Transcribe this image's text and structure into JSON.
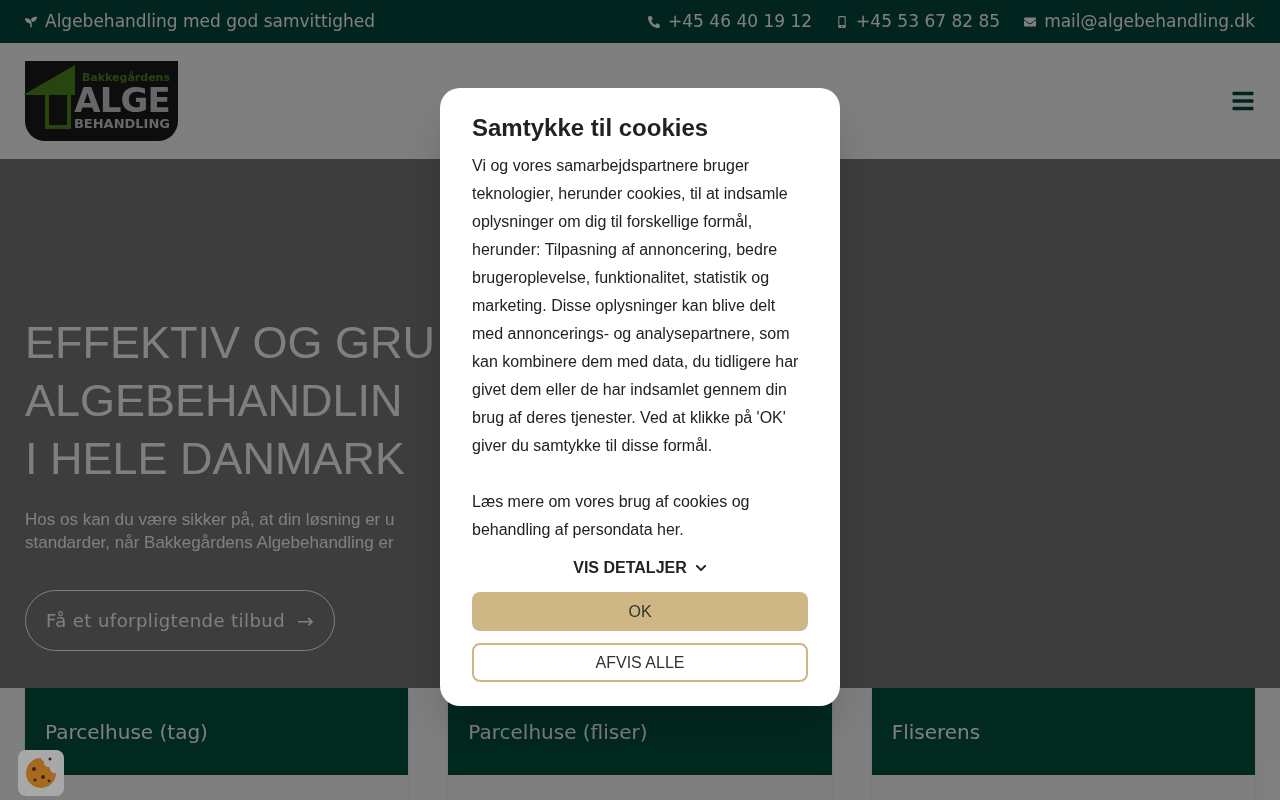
{
  "top_bar": {
    "tagline": "Algebehandling med god samvittighed",
    "contacts": [
      {
        "kind": "phone",
        "text": "+45 46 40 19 12"
      },
      {
        "kind": "mobile",
        "text": "+45 53 67 82 85"
      },
      {
        "kind": "mail",
        "text": "mail@algebehandling.dk"
      }
    ]
  },
  "logo": {
    "line_1": "Bakkegårdens",
    "line_2": "ALGE",
    "line_3": "BEHANDLING"
  },
  "hero": {
    "heading_lines": [
      "EFFEKTIV OG GRU",
      "ALGEBEHANDLIN",
      "I HELE DANMARK"
    ],
    "text_lines": [
      "Hos os kan du være sikker på, at din løsning er u",
      "standarder, når Bakkegårdens Algebehandling er"
    ],
    "button": "Få et uforpligtende tilbud",
    "button_arrow": "→"
  },
  "cards": [
    {
      "title": "Parcelhuse (tag)"
    },
    {
      "title": "Parcelhuse (fliser)"
    },
    {
      "title": "Fliserens"
    }
  ],
  "cookie_dialog": {
    "title": "Samtykke til cookies",
    "body": "Vi og vores samarbejdspartnere bruger teknologier, herunder cookies, til at indsamle oplysninger om dig til forskellige formål, herunder: Tilpasning af annoncering, bedre brugeroplevelse, funktionalitet, statistik og marketing. Disse oplysninger kan blive delt med annoncerings- og analysepartnere, som kan kombinere dem med data, du tidligere har givet dem eller de har indsamlet gennem din brug af deres tjenester. Ved at klikke på 'OK' giver du samtykke til disse formål.",
    "more": "Læs mere om vores brug af cookies og behandling af persondata her.",
    "details": "VIS DETALJER",
    "accept": "OK",
    "reject": "AFVIS ALLE"
  }
}
